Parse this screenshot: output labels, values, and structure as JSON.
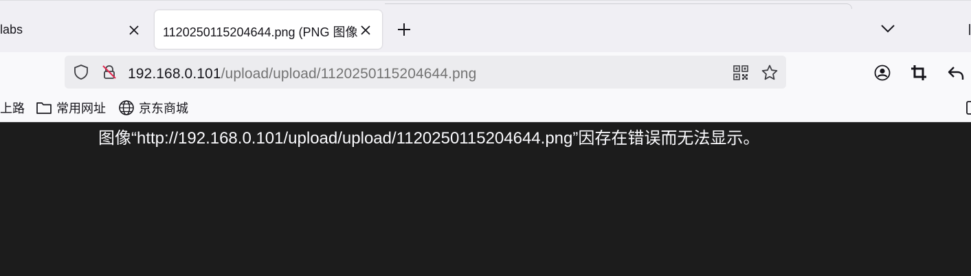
{
  "tabs": [
    {
      "title": "labs",
      "active": false,
      "close_icon": "close-icon"
    },
    {
      "title": "1120250115204644.png (PNG 图像",
      "active": true,
      "close_icon": "close-icon"
    }
  ],
  "toolbar_icons": {
    "new_tab": "plus-icon",
    "tab_list": "chevron-down-icon",
    "shield": "shield-icon",
    "insecure": "insecure-lock-icon",
    "qr": "qr-code-icon",
    "bookmark": "star-icon",
    "account": "account-icon",
    "screenshot": "crop-icon",
    "back": "back-arrow-icon"
  },
  "urlbar": {
    "host": "192.168.0.101",
    "path": "/upload/upload/1120250115204644.png"
  },
  "bookmarks": [
    {
      "label": "上路",
      "icon": ""
    },
    {
      "label": "常用网址",
      "icon": "folder-icon"
    },
    {
      "label": "京东商城",
      "icon": "globe-icon"
    }
  ],
  "content": {
    "error_message": "图像“http://192.168.0.101/upload/upload/1120250115204644.png”因存在错误而无法显示。"
  },
  "colors": {
    "tabstrip_bg": "#f0eff4",
    "toolbar_bg": "#f9f9fb",
    "urlbar_bg": "#ececef",
    "content_bg": "#1c1c1c",
    "text_dark": "#15141a",
    "text_dim": "#737373",
    "text_light": "#fbfbfe"
  }
}
